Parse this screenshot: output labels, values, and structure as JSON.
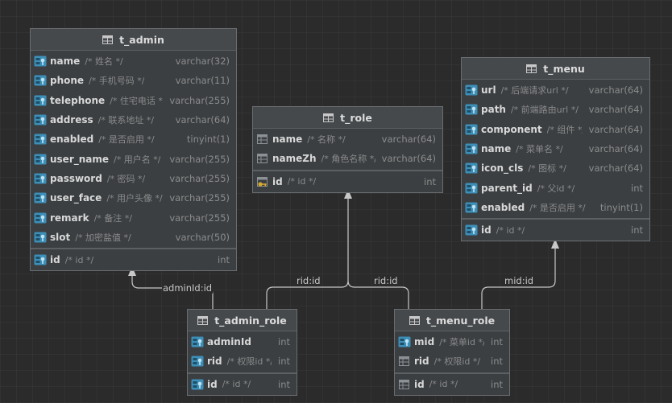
{
  "tables": [
    {
      "id": "t_admin",
      "title": "t_admin",
      "fields": [
        {
          "name": "name",
          "comment": "/* 姓名 */",
          "type": "varchar(32)",
          "kind": "index"
        },
        {
          "name": "phone",
          "comment": "/* 手机号码 */",
          "type": "varchar(11)",
          "kind": "index"
        },
        {
          "name": "telephone",
          "comment": "/* 住宅电话 */",
          "type": "varchar(255)",
          "kind": "index"
        },
        {
          "name": "address",
          "comment": "/* 联系地址 */",
          "type": "varchar(64)",
          "kind": "index"
        },
        {
          "name": "enabled",
          "comment": "/* 是否启用 */",
          "type": "tinyint(1)",
          "kind": "index"
        },
        {
          "name": "user_name",
          "comment": "/* 用户名 */",
          "type": "varchar(255)",
          "kind": "index"
        },
        {
          "name": "password",
          "comment": "/* 密码 */",
          "type": "varchar(255)",
          "kind": "index"
        },
        {
          "name": "user_face",
          "comment": "/* 用户头像 */",
          "type": "varchar(255)",
          "kind": "index"
        },
        {
          "name": "remark",
          "comment": "/* 备注 */",
          "type": "varchar(255)",
          "kind": "index"
        },
        {
          "name": "slot",
          "comment": "/* 加密盐值 */",
          "type": "varchar(50)",
          "kind": "index"
        }
      ],
      "keys": [
        {
          "name": "id",
          "comment": "/* id */",
          "type": "int",
          "kind": "index"
        }
      ]
    },
    {
      "id": "t_role",
      "title": "t_role",
      "fields": [
        {
          "name": "name",
          "comment": "/* 名称 */",
          "type": "varchar(64)",
          "kind": "column"
        },
        {
          "name": "nameZh",
          "comment": "/* 角色名称 */",
          "type": "varchar(64)",
          "kind": "column"
        }
      ],
      "keys": [
        {
          "name": "id",
          "comment": "/* id */",
          "type": "int",
          "kind": "pk"
        }
      ]
    },
    {
      "id": "t_menu",
      "title": "t_menu",
      "fields": [
        {
          "name": "url",
          "comment": "/* 后端请求url */",
          "type": "varchar(64)",
          "kind": "index"
        },
        {
          "name": "path",
          "comment": "/* 前端路由url */",
          "type": "varchar(64)",
          "kind": "index"
        },
        {
          "name": "component",
          "comment": "/* 组件 */",
          "type": "varchar(64)",
          "kind": "index"
        },
        {
          "name": "name",
          "comment": "/* 菜单名 */",
          "type": "varchar(64)",
          "kind": "index"
        },
        {
          "name": "icon_cls",
          "comment": "/* 图标 */",
          "type": "varchar(64)",
          "kind": "index"
        },
        {
          "name": "parent_id",
          "comment": "/* 父id */",
          "type": "int",
          "kind": "index"
        },
        {
          "name": "enabled",
          "comment": "/* 是否启用 */",
          "type": "tinyint(1)",
          "kind": "index"
        }
      ],
      "keys": [
        {
          "name": "id",
          "comment": "/* id */",
          "type": "int",
          "kind": "index"
        }
      ]
    },
    {
      "id": "t_admin_role",
      "title": "t_admin_role",
      "fields": [
        {
          "name": "adminId",
          "comment": "",
          "type": "int",
          "kind": "index"
        },
        {
          "name": "rid",
          "comment": "/* 权限id */",
          "type": "int",
          "kind": "index"
        }
      ],
      "keys": [
        {
          "name": "id",
          "comment": "/* id */",
          "type": "int",
          "kind": "index"
        }
      ]
    },
    {
      "id": "t_menu_role",
      "title": "t_menu_role",
      "fields": [
        {
          "name": "mid",
          "comment": "/* 菜单id */",
          "type": "int",
          "kind": "index"
        },
        {
          "name": "rid",
          "comment": "/* 权限id */",
          "type": "int",
          "kind": "column"
        }
      ],
      "keys": [
        {
          "name": "id",
          "comment": "/* id */",
          "type": "int",
          "kind": "column"
        }
      ]
    }
  ],
  "edges": [
    {
      "id": "admin-role-to-admin",
      "label": "adminId:id"
    },
    {
      "id": "admin-role-to-role",
      "label": "rid:id"
    },
    {
      "id": "menu-role-to-role",
      "label": "rid:id"
    },
    {
      "id": "menu-role-to-menu",
      "label": "mid:id"
    }
  ],
  "colors": {
    "line": "#c8c8c8",
    "icon": "#3d8fb8",
    "key": "#d4a92e",
    "column": "#8c9196"
  }
}
